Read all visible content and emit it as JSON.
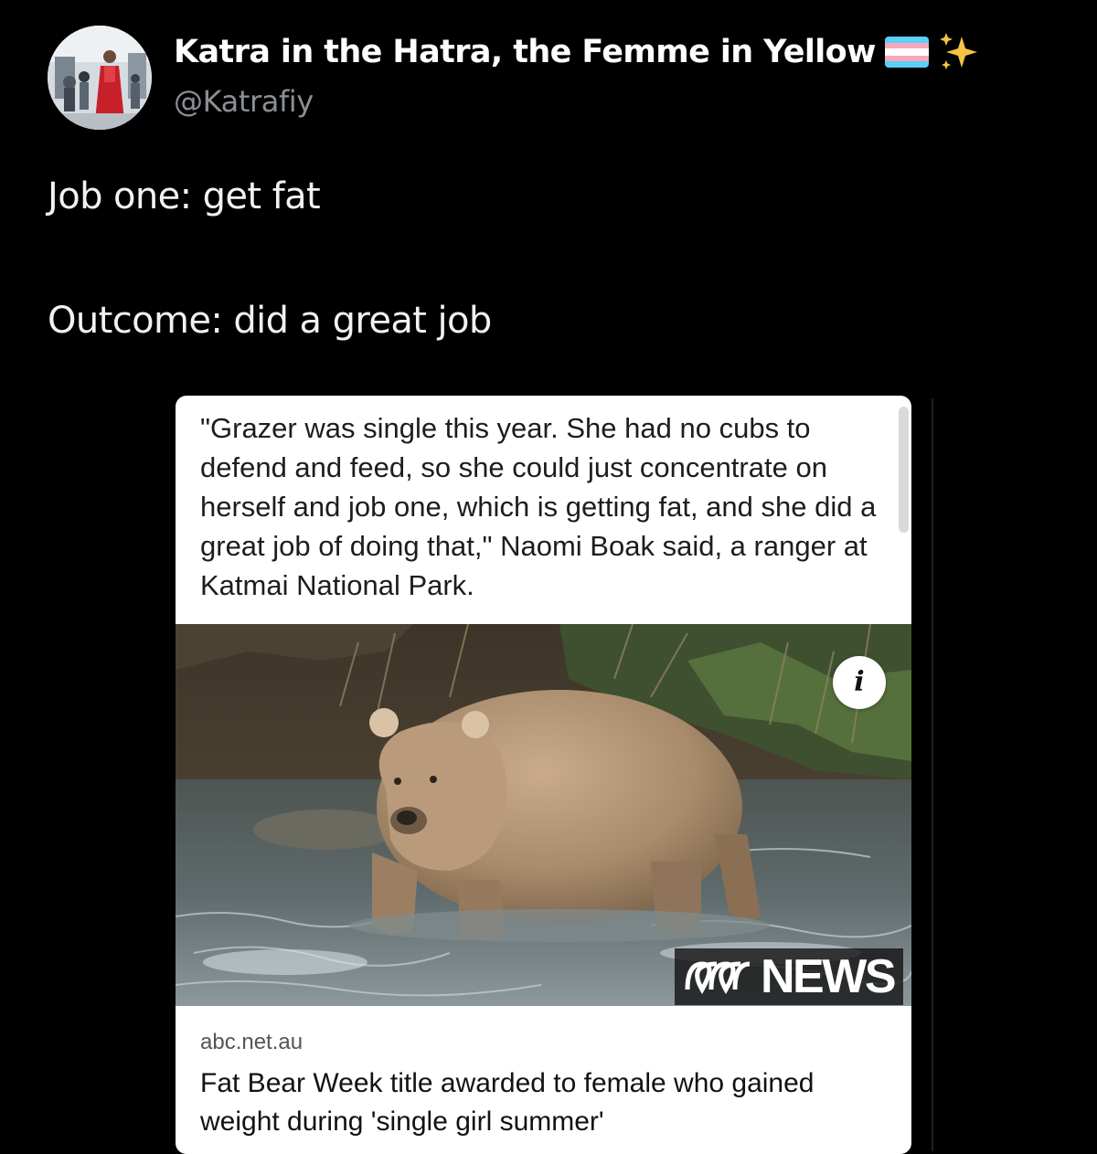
{
  "tweet": {
    "author": {
      "display_name": "Katra in the Hatra, the Femme in Yellow",
      "handle": "@Katrafiy",
      "name_emojis": [
        "transgender-flag",
        "sparkles"
      ]
    },
    "text_lines": [
      "Job one: get fat",
      "Outcome: did a great job"
    ]
  },
  "card": {
    "quote": "\"Grazer was single this year. She had no cubs to defend and feed, so she could just concentrate on herself and job one, which is getting fat, and she did a great job of doing that,\" Naomi Boak said, a ranger at Katmai National Park.",
    "image": {
      "info_button_label": "i",
      "watermark": "NEWS"
    },
    "domain": "abc.net.au",
    "headline": "Fat Bear Week title awarded to female who gained weight during 'single girl summer'"
  },
  "colors": {
    "background": "#000000",
    "text_primary": "#ffffff",
    "text_secondary": "#8b8f94",
    "card_background": "#ffffff",
    "flag_blue": "#5BCEFA",
    "flag_pink": "#F5A9B8",
    "sparkle_yellow": "#F6C343"
  }
}
